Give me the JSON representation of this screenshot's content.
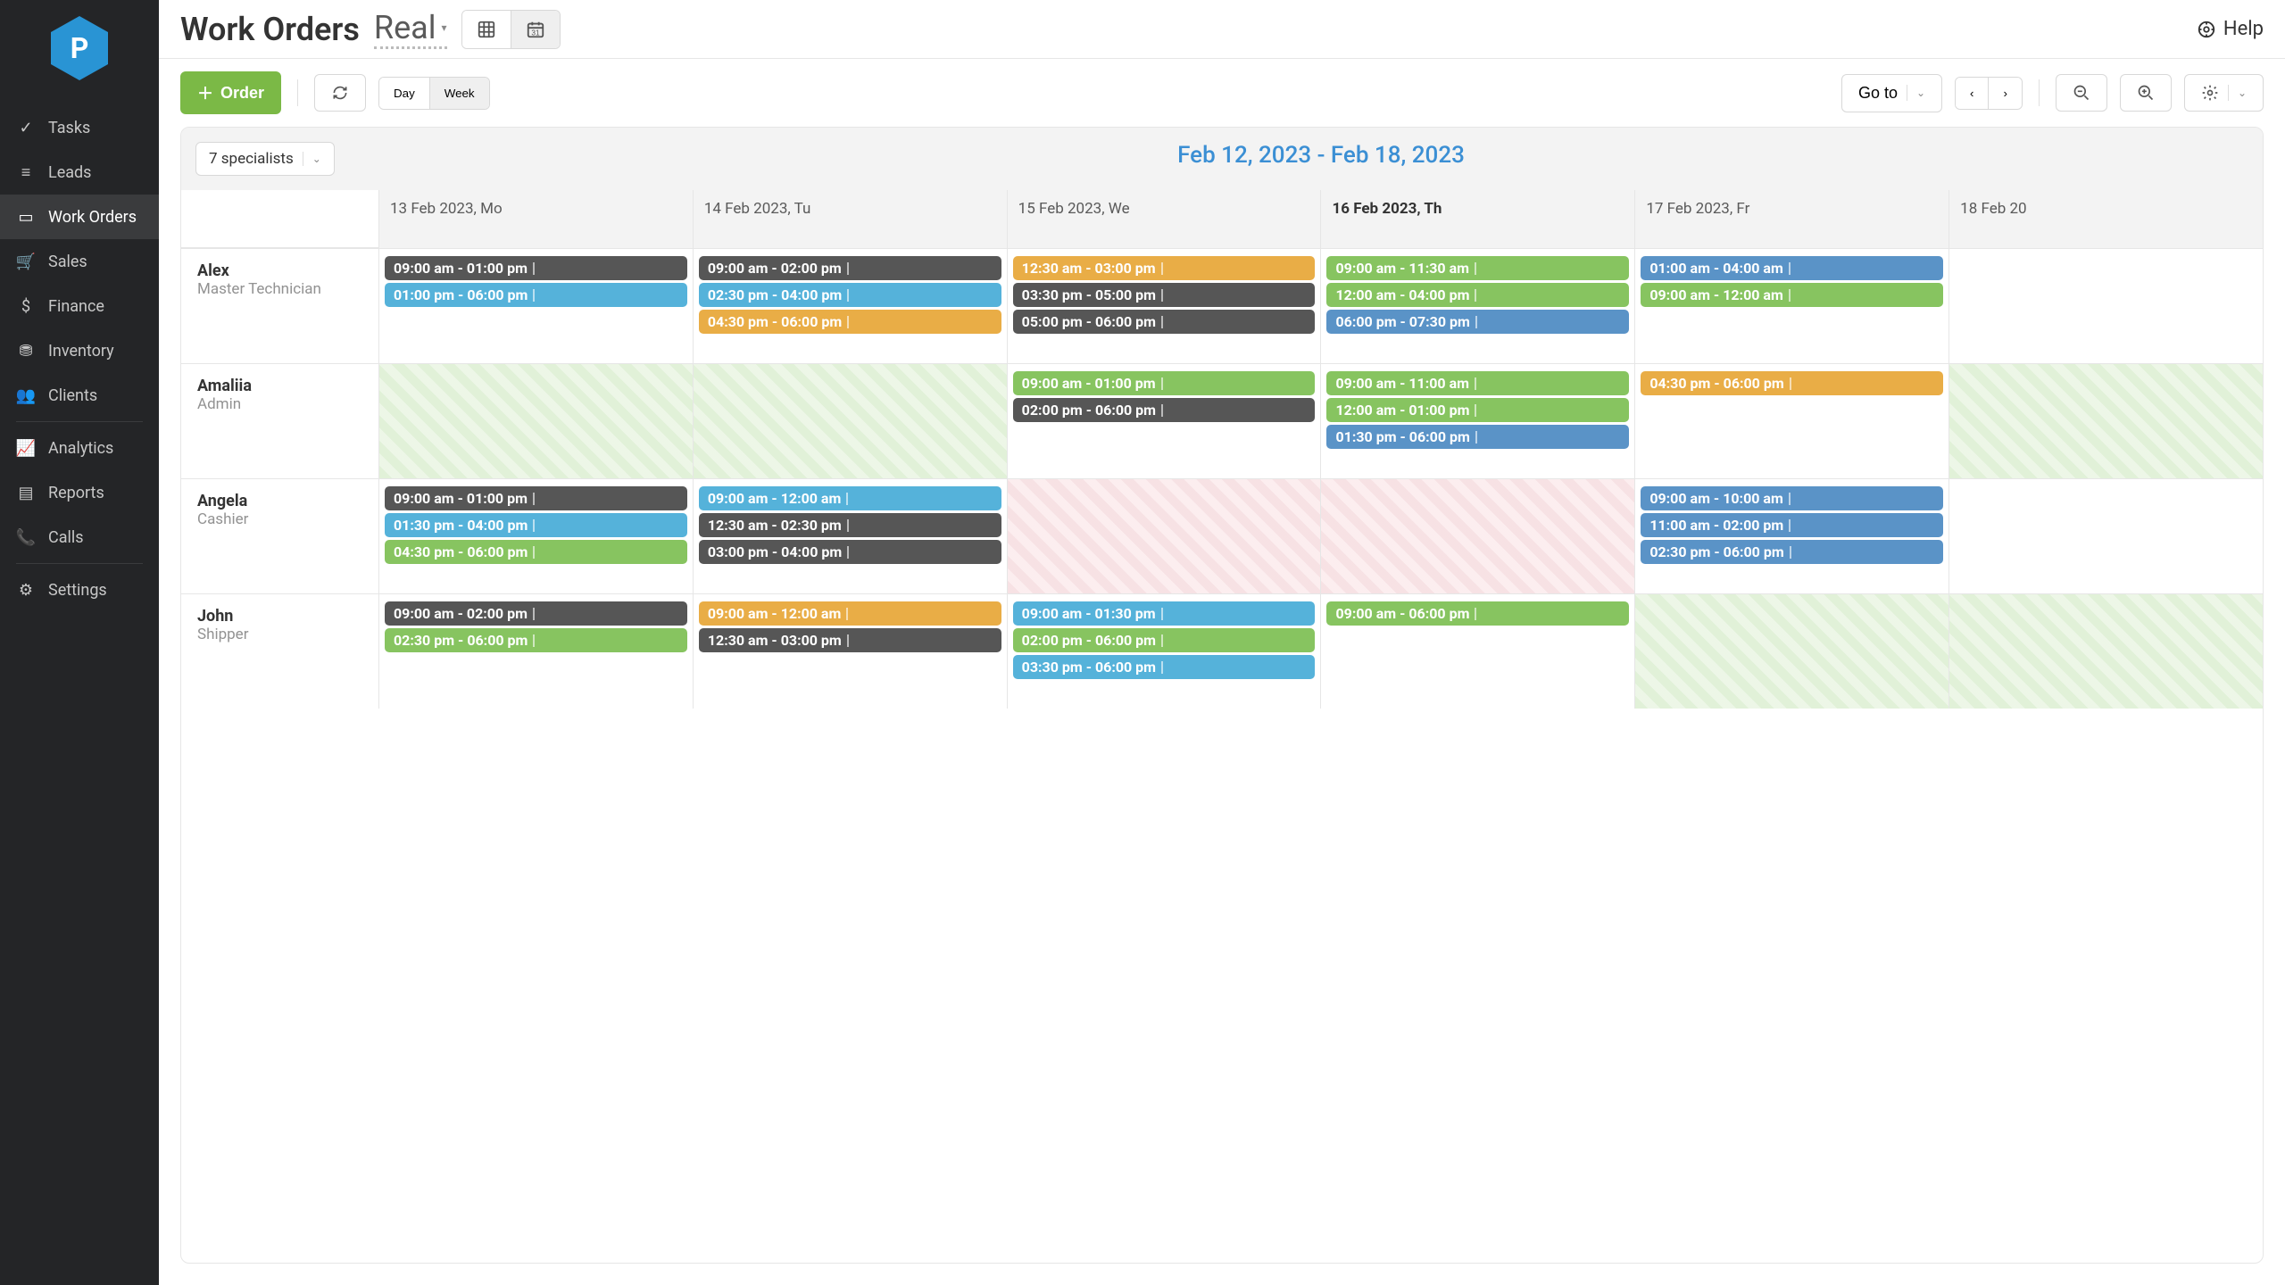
{
  "sidebar": {
    "items": [
      {
        "label": "Tasks"
      },
      {
        "label": "Leads"
      },
      {
        "label": "Work Orders"
      },
      {
        "label": "Sales"
      },
      {
        "label": "Finance"
      },
      {
        "label": "Inventory"
      },
      {
        "label": "Clients"
      },
      {
        "label": "Analytics"
      },
      {
        "label": "Reports"
      },
      {
        "label": "Calls"
      },
      {
        "label": "Settings"
      }
    ]
  },
  "header": {
    "title": "Work Orders",
    "env": "Real",
    "help": "Help"
  },
  "toolbar": {
    "new_order": "Order",
    "day": "Day",
    "week": "Week",
    "goto": "Go to",
    "specialists": "7 specialists"
  },
  "calendar": {
    "range": "Feb 12, 2023 - Feb 18, 2023",
    "days": [
      {
        "label": "13 Feb 2023, Mo"
      },
      {
        "label": "14 Feb 2023, Tu"
      },
      {
        "label": "15 Feb 2023, We"
      },
      {
        "label": "16 Feb 2023, Th",
        "bold": true
      },
      {
        "label": "17 Feb 2023, Fr"
      },
      {
        "label": "18 Feb 20"
      }
    ],
    "rows": [
      {
        "name": "Alex",
        "role": "Master Technician",
        "cells": [
          [
            {
              "t": "09:00 am - 01:00 pm",
              "c": "dark"
            },
            {
              "t": "01:00 pm - 06:00 pm",
              "c": "blue"
            }
          ],
          [
            {
              "t": "09:00 am - 02:00 pm",
              "c": "dark"
            },
            {
              "t": "02:30 pm - 04:00 pm",
              "c": "blue"
            },
            {
              "t": "04:30 pm - 06:00 pm",
              "c": "orange"
            }
          ],
          [
            {
              "t": "12:30 am - 03:00 pm",
              "c": "orange"
            },
            {
              "t": "03:30 pm - 05:00 pm",
              "c": "dark"
            },
            {
              "t": "05:00 pm - 06:00 pm",
              "c": "dark"
            }
          ],
          [
            {
              "t": "09:00 am - 11:30 am",
              "c": "green"
            },
            {
              "t": "12:00 am - 04:00 pm",
              "c": "green"
            },
            {
              "t": "06:00 pm - 07:30 pm",
              "c": "lblue"
            }
          ],
          [
            {
              "t": "01:00 am - 04:00 am",
              "c": "lblue"
            },
            {
              "t": "09:00 am - 12:00 am",
              "c": "green"
            }
          ],
          []
        ]
      },
      {
        "name": "Amaliia",
        "role": "Admin",
        "cells": [
          {
            "hatch": "green",
            "events": []
          },
          {
            "hatch": "green",
            "events": []
          },
          [
            {
              "t": "09:00 am - 01:00 pm",
              "c": "green"
            },
            {
              "t": "02:00 pm - 06:00 pm",
              "c": "dark"
            }
          ],
          [
            {
              "t": "09:00 am - 11:00 am",
              "c": "green"
            },
            {
              "t": "12:00 am - 01:00 pm",
              "c": "green"
            },
            {
              "t": "01:30 pm - 06:00 pm",
              "c": "lblue"
            }
          ],
          [
            {
              "t": "04:30 pm - 06:00 pm",
              "c": "orange"
            }
          ],
          {
            "hatch": "green",
            "events": []
          }
        ]
      },
      {
        "name": "Angela",
        "role": "Cashier",
        "cells": [
          [
            {
              "t": "09:00 am - 01:00 pm",
              "c": "dark"
            },
            {
              "t": "01:30 pm - 04:00 pm",
              "c": "blue"
            },
            {
              "t": "04:30 pm - 06:00 pm",
              "c": "green"
            }
          ],
          [
            {
              "t": "09:00 am - 12:00 am",
              "c": "blue"
            },
            {
              "t": "12:30 am - 02:30 pm",
              "c": "dark"
            },
            {
              "t": "03:00 pm - 04:00 pm",
              "c": "dark"
            }
          ],
          {
            "hatch": "pink",
            "events": []
          },
          {
            "hatch": "pink",
            "events": []
          },
          [
            {
              "t": "09:00 am - 10:00 am",
              "c": "lblue"
            },
            {
              "t": "11:00 am - 02:00 pm",
              "c": "lblue"
            },
            {
              "t": "02:30 pm - 06:00 pm",
              "c": "lblue"
            }
          ],
          []
        ]
      },
      {
        "name": "John",
        "role": "Shipper",
        "cells": [
          [
            {
              "t": "09:00 am - 02:00 pm",
              "c": "dark"
            },
            {
              "t": "02:30 pm - 06:00 pm",
              "c": "green"
            }
          ],
          [
            {
              "t": "09:00 am - 12:00 am",
              "c": "orange"
            },
            {
              "t": "12:30 am - 03:00 pm",
              "c": "dark"
            }
          ],
          [
            {
              "t": "09:00 am - 01:30 pm",
              "c": "blue"
            },
            {
              "t": "02:00 pm - 06:00 pm",
              "c": "green"
            },
            {
              "t": "03:30 pm - 06:00 pm",
              "c": "blue"
            }
          ],
          [
            {
              "t": "09:00 am - 06:00 pm",
              "c": "green"
            }
          ],
          {
            "hatch": "green",
            "events": []
          },
          {
            "hatch": "green",
            "events": []
          }
        ]
      }
    ]
  }
}
